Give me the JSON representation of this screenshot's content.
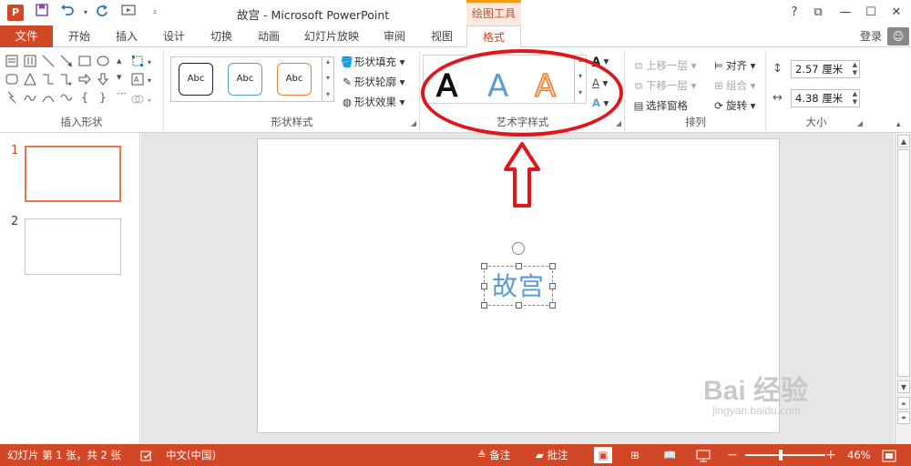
{
  "window": {
    "title": "故宫 - Microsoft PowerPoint",
    "context_tab_header": "绘图工具",
    "help": "?",
    "minimize": "—",
    "restore": "☐",
    "close": "✕",
    "ribbon_display": "⧉"
  },
  "tabs": {
    "file": "文件",
    "items": [
      "开始",
      "插入",
      "设计",
      "切换",
      "动画",
      "幻灯片放映",
      "审阅",
      "视图",
      "格式"
    ],
    "active": "格式",
    "login": "登录"
  },
  "ribbon": {
    "insert_shapes": {
      "label": "插入形状"
    },
    "shape_styles": {
      "label": "形状样式",
      "gallery": [
        "Abc",
        "Abc",
        "Abc"
      ],
      "fill": "形状填充",
      "outline": "形状轮廓",
      "effects": "形状效果"
    },
    "wordart_styles": {
      "label": "艺术字样式",
      "gallery": [
        "A",
        "A",
        "A"
      ]
    },
    "arrange": {
      "label": "排列",
      "bring_forward": "上移一层",
      "send_backward": "下移一层",
      "selection_pane": "选择窗格",
      "align": "对齐",
      "group": "组合",
      "rotate": "旋转"
    },
    "size": {
      "label": "大小",
      "height": "2.57 厘米",
      "width": "4.38 厘米"
    }
  },
  "slides": [
    {
      "number": "1",
      "selected": true
    },
    {
      "number": "2",
      "selected": false
    }
  ],
  "slide_content": {
    "textbox_text": "故宫"
  },
  "status": {
    "slide_info": "幻灯片 第 1 张，共 2 张",
    "language": "中文(中国)",
    "notes": "备注",
    "comments": "批注",
    "zoom": "46%",
    "zoom_minus": "−",
    "zoom_plus": "+"
  },
  "watermark": {
    "brand": "Bai 经验",
    "url": "jingyan.baidu.com"
  },
  "colors": {
    "accent": "#d24726",
    "annotation_red": "#e0161d",
    "wordart_blue": "#5b9bd5",
    "wordart_orange": "#ed7d31"
  }
}
